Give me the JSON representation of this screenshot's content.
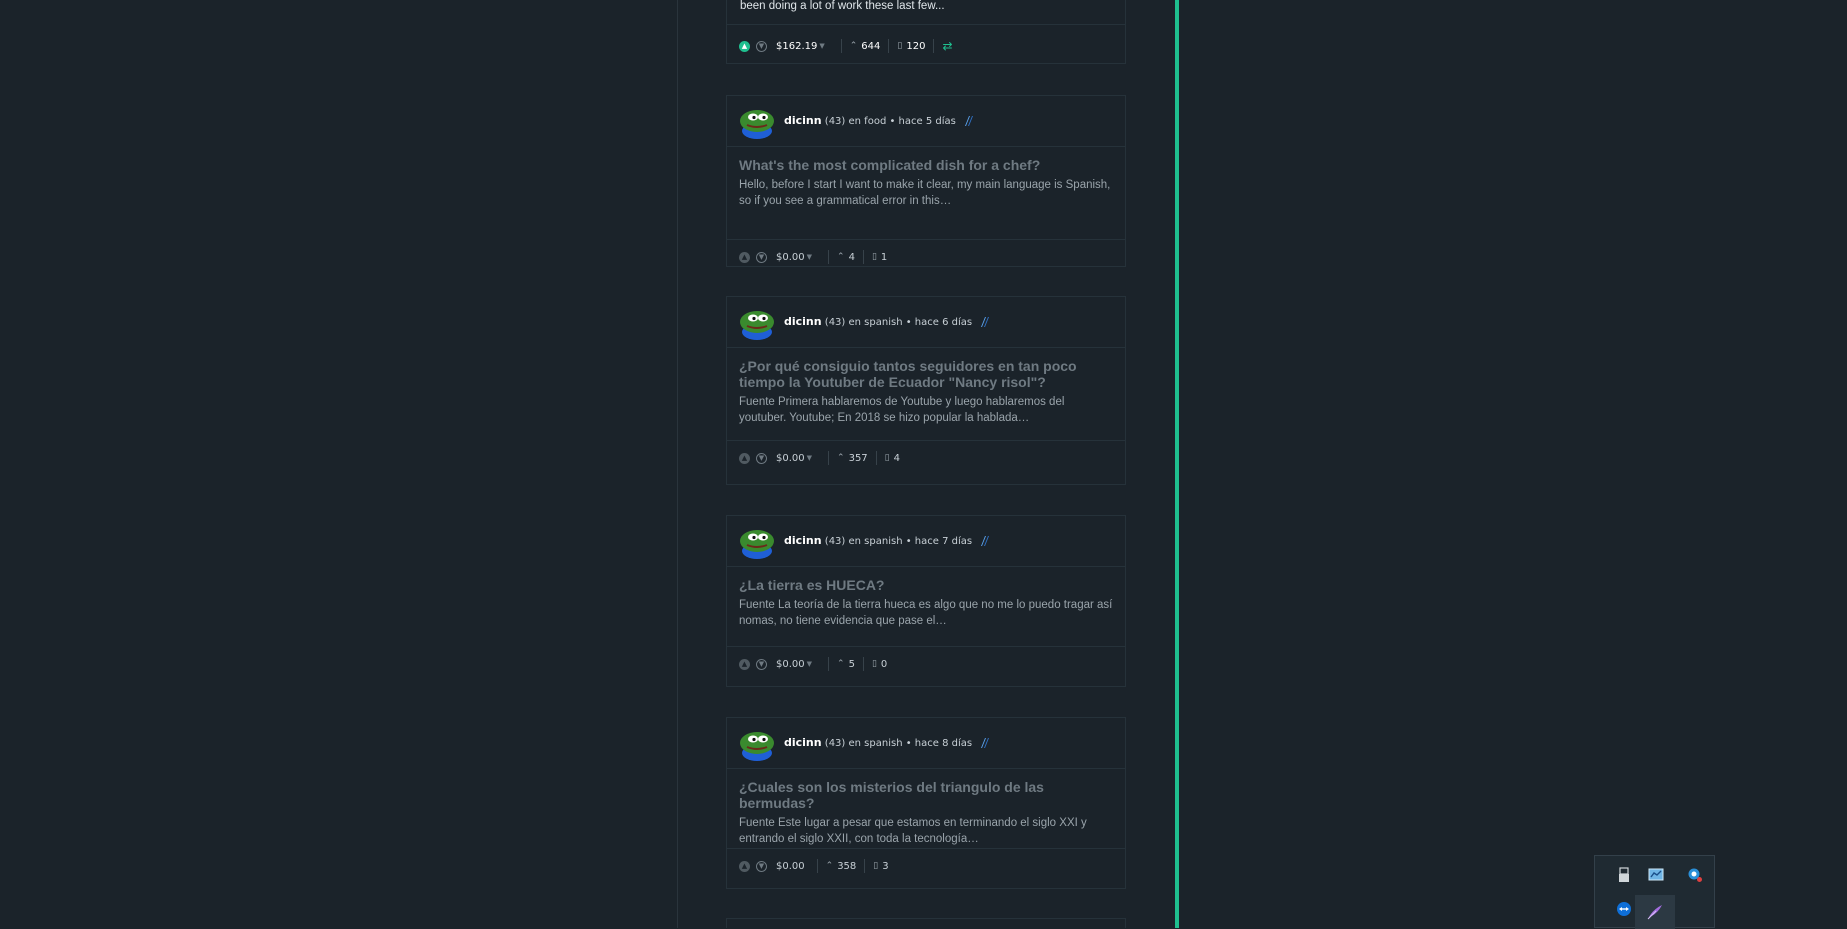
{
  "cards": [
    {
      "excerpt_fragment": "been doing a lot of work these last few...",
      "payout": "$162.19",
      "votes": "644",
      "comments": "120",
      "voted": true,
      "reblog": true
    },
    {
      "author": "dicinn",
      "reputation": "(43)",
      "meta": "en food • hace 5 días",
      "title": "What's the most complicated dish for a chef?",
      "excerpt": "Hello, before I start I want to make it clear, my main language is Spanish, so if you see a grammatical error in this…",
      "payout": "$0.00",
      "votes": "4",
      "comments": "1"
    },
    {
      "author": "dicinn",
      "reputation": "(43)",
      "meta": "en spanish • hace 6 días",
      "title": "¿Por qué consiguio tantos seguidores en tan poco tiempo la Youtuber de Ecuador \"Nancy risol\"?",
      "excerpt": "Fuente Primera hablaremos de Youtube y luego hablaremos del youtuber. Youtube; En 2018 se hizo popular la hablada…",
      "payout": "$0.00",
      "votes": "357",
      "comments": "4"
    },
    {
      "author": "dicinn",
      "reputation": "(43)",
      "meta": "en spanish • hace 7 días",
      "title": "¿La tierra es HUECA?",
      "excerpt": "Fuente La teoría de la tierra hueca es algo que no me lo puedo tragar así nomas, no tiene evidencia que pase el…",
      "payout": "$0.00",
      "votes": "5",
      "comments": "0"
    },
    {
      "author": "dicinn",
      "reputation": "(43)",
      "meta": "en spanish • hace 8 días",
      "title": "¿Cuales son los misterios del triangulo de las bermudas?",
      "excerpt": "Fuente Este lugar a pesar que estamos en terminando el siglo XXI y entrando el siglo XXII, con toda la tecnología…",
      "payout": "$0.00",
      "votes": "358",
      "comments": "3"
    }
  ],
  "colors": {
    "background": "#1b232a",
    "accent": "#1fbf8f",
    "card_border": "#26323a",
    "title": "#6f7a82"
  },
  "tray_icons": [
    "usb-drive-icon",
    "network-monitor-icon",
    "search-app-icon",
    "teamviewer-icon",
    "feather-app-icon"
  ]
}
